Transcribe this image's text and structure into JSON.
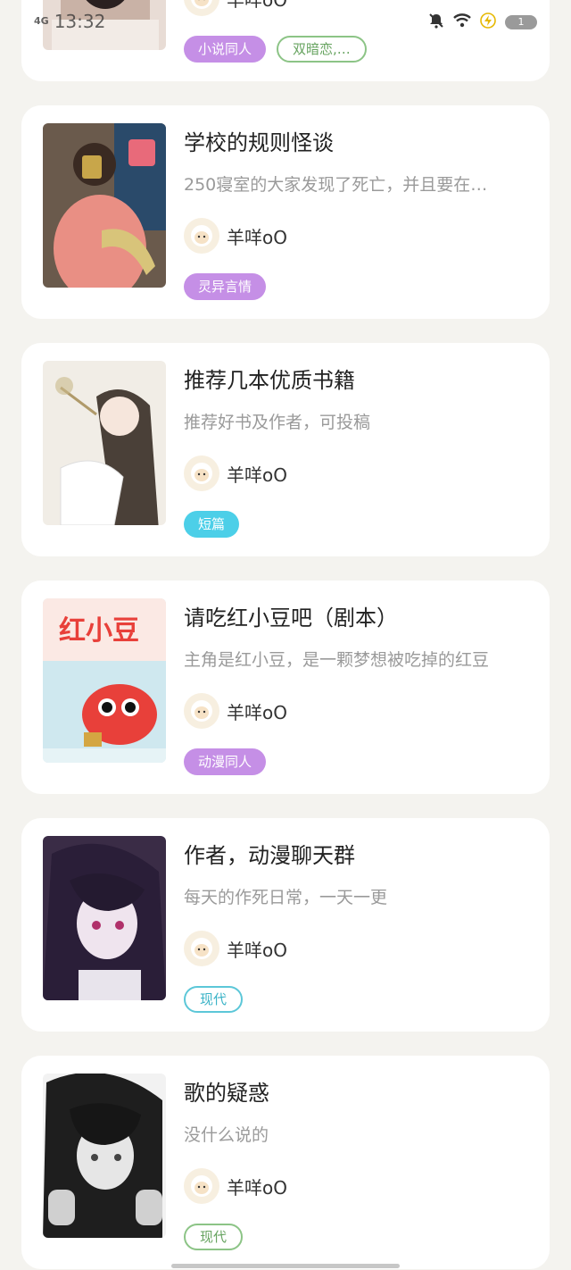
{
  "status_bar": {
    "network": "4G",
    "time": "13:32",
    "battery": "1"
  },
  "colors": {
    "background": "#f4f3ef",
    "tag_purple": "#c58fe6",
    "tag_cyan": "#4ccfe8",
    "tag_outline_cyan": "#5cc7d8",
    "tag_outline_green": "#8cc486"
  },
  "cards": [
    {
      "title": "",
      "description": "",
      "author": "羊咩oO",
      "tags": [
        "小说同人",
        "双暗恋,…"
      ]
    },
    {
      "title": "学校的规则怪谈",
      "description": "250寝室的大家发现了死亡，并且要在…",
      "author": "羊咩oO",
      "tags": [
        "灵异言情"
      ]
    },
    {
      "title": "推荐几本优质书籍",
      "description": "推荐好书及作者，可投稿",
      "author": "羊咩oO",
      "tags": [
        "短篇"
      ]
    },
    {
      "title": "请吃红小豆吧（剧本）",
      "description": "主角是红小豆，是一颗梦想被吃掉的红豆",
      "author": "羊咩oO",
      "tags": [
        "动漫同人"
      ]
    },
    {
      "title": "作者，动漫聊天群",
      "description": "每天的作死日常，一天一更",
      "author": "羊咩oO",
      "tags": [
        "现代"
      ]
    },
    {
      "title": "歌的疑惑",
      "description": "没什么说的",
      "author": "羊咩oO",
      "tags": [
        "现代"
      ]
    }
  ]
}
